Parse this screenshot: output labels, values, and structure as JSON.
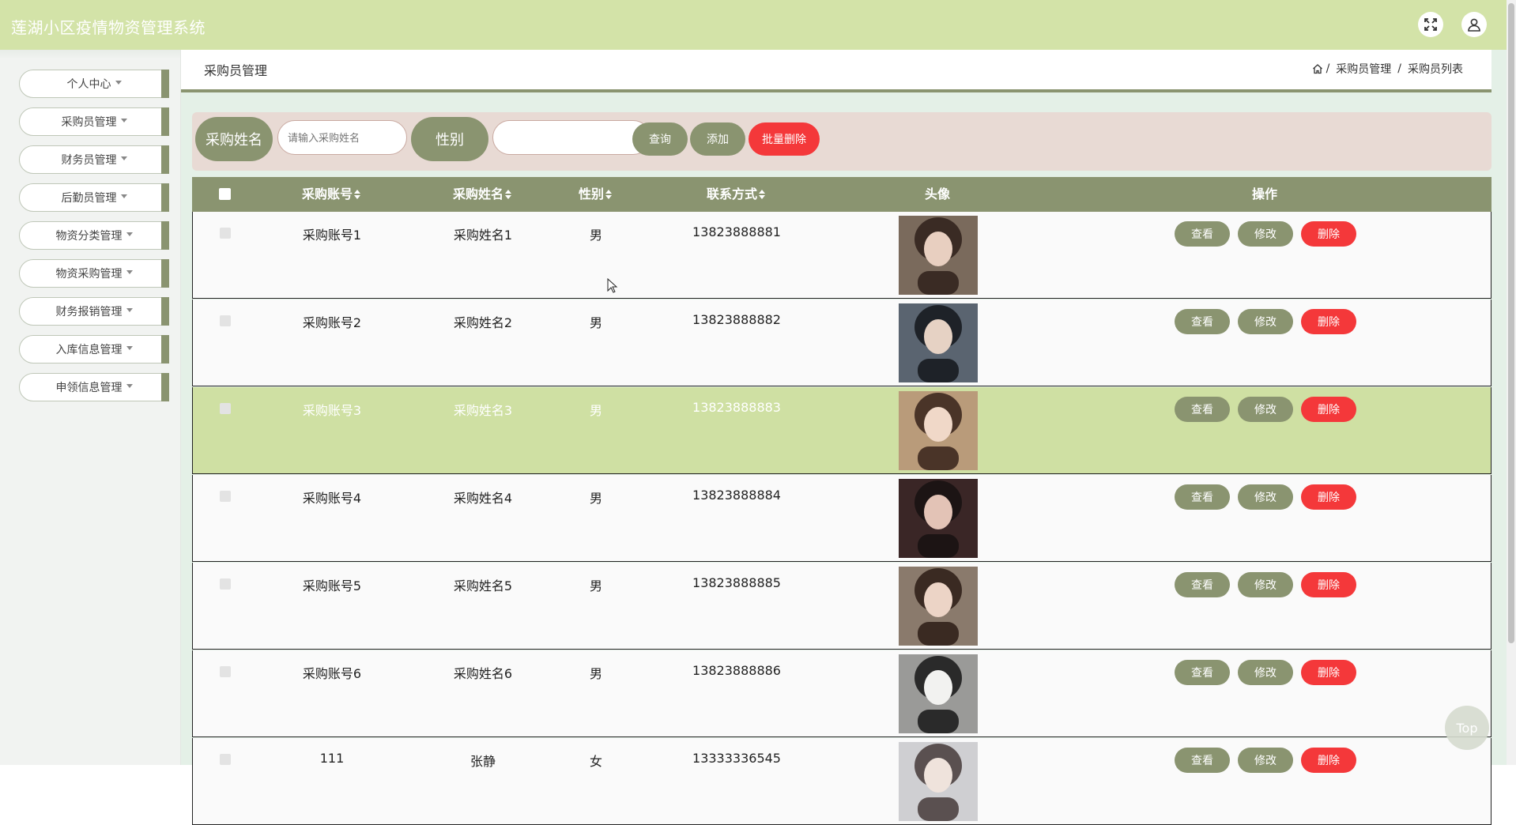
{
  "header": {
    "app_title": "莲湖小区疫情物资管理系统",
    "icons": [
      "fullscreen-icon",
      "user-icon"
    ]
  },
  "sidebar": {
    "items": [
      {
        "label": "个人中心"
      },
      {
        "label": "采购员管理"
      },
      {
        "label": "财务员管理"
      },
      {
        "label": "后勤员管理"
      },
      {
        "label": "物资分类管理"
      },
      {
        "label": "物资采购管理"
      },
      {
        "label": "财务报销管理"
      },
      {
        "label": "入库信息管理"
      },
      {
        "label": "申领信息管理"
      }
    ]
  },
  "breadcrumb": {
    "page_title": "采购员管理",
    "crumbs": [
      "采购员管理",
      "采购员列表"
    ],
    "separator": "/"
  },
  "search": {
    "name_label": "采购姓名",
    "name_placeholder": "请输入采购姓名",
    "gender_label": "性别",
    "gender_selected": "",
    "query_button": "查询",
    "add_button": "添加",
    "batch_delete_button": "批量删除"
  },
  "table": {
    "columns": [
      "采购账号",
      "采购姓名",
      "性别",
      "联系方式",
      "头像",
      "操作"
    ],
    "rows": [
      {
        "account": "采购账号1",
        "name": "采购姓名1",
        "gender": "男",
        "phone": "13823888881"
      },
      {
        "account": "采购账号2",
        "name": "采购姓名2",
        "gender": "男",
        "phone": "13823888882"
      },
      {
        "account": "采购账号3",
        "name": "采购姓名3",
        "gender": "男",
        "phone": "13823888883"
      },
      {
        "account": "采购账号4",
        "name": "采购姓名4",
        "gender": "男",
        "phone": "13823888884"
      },
      {
        "account": "采购账号5",
        "name": "采购姓名5",
        "gender": "男",
        "phone": "13823888885"
      },
      {
        "account": "采购账号6",
        "name": "采购姓名6",
        "gender": "男",
        "phone": "13823888886"
      },
      {
        "account": "111",
        "name": "张静",
        "gender": "女",
        "phone": "13333336545"
      }
    ],
    "actions": {
      "view": "查看",
      "edit": "修改",
      "delete": "删除"
    }
  },
  "back_to_top": "Top",
  "colors": {
    "header_bg": "#d3e3a8",
    "accent_olive": "#8a9470",
    "danger_red": "#f4383a",
    "highlight_row": "#cfe0a3",
    "search_bg": "#e8dad4",
    "content_bg": "#e4f0e7"
  }
}
